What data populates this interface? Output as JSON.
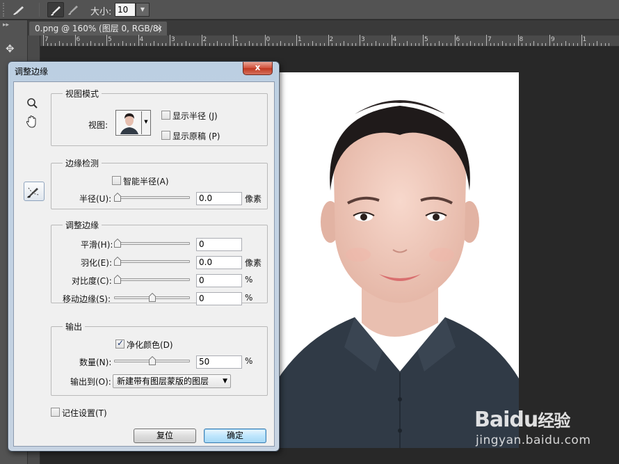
{
  "options_bar": {
    "size_label": "大小:",
    "size_value": "10"
  },
  "document_tab": {
    "title": "0.png @ 160% (图层 0, RGB/8)",
    "close": "×"
  },
  "ruler": {
    "h_labels": [
      "7",
      "6",
      "5",
      "4",
      "3",
      "2",
      "1",
      "0",
      "1",
      "2",
      "3",
      "4",
      "5",
      "6",
      "7",
      "8",
      "9",
      "1"
    ]
  },
  "dialog": {
    "title": "调整边缘",
    "close": "x",
    "view_mode": {
      "legend": "视图模式",
      "view_label": "视图:",
      "show_radius": {
        "label": "显示半径 (J)",
        "checked": false
      },
      "show_original": {
        "label": "显示原稿 (P)",
        "checked": false
      }
    },
    "edge_detection": {
      "legend": "边缘检测",
      "smart_radius": {
        "label": "智能半径(A)",
        "checked": false
      },
      "radius_label": "半径(U):",
      "radius_value": "0.0",
      "radius_unit": "像素",
      "radius_level": 0
    },
    "adjust_edge": {
      "legend": "调整边缘",
      "smooth_label": "平滑(H):",
      "smooth_value": "0",
      "smooth_level": 0,
      "feather_label": "羽化(E):",
      "feather_value": "0.0",
      "feather_unit": "像素",
      "feather_level": 0,
      "contrast_label": "对比度(C):",
      "contrast_value": "0",
      "contrast_unit": "%",
      "contrast_level": 0,
      "shift_label": "移动边缘(S):",
      "shift_value": "0",
      "shift_unit": "%",
      "shift_level": 0.5
    },
    "output": {
      "legend": "输出",
      "decontaminate": {
        "label": "净化颜色(D)",
        "checked": true
      },
      "amount_label": "数量(N):",
      "amount_value": "50",
      "amount_unit": "%",
      "amount_level": 0.5,
      "output_to_label": "输出到(O):",
      "output_to_value": "新建带有图层蒙版的图层"
    },
    "remember": {
      "label": "记住设置(T)",
      "checked": false
    },
    "reset_label": "复位",
    "ok_label": "确定"
  },
  "watermark": {
    "brand_a": "Bai",
    "brand_b": "du",
    "brand_c": "经验",
    "url": "jingyan.baidu.com"
  }
}
